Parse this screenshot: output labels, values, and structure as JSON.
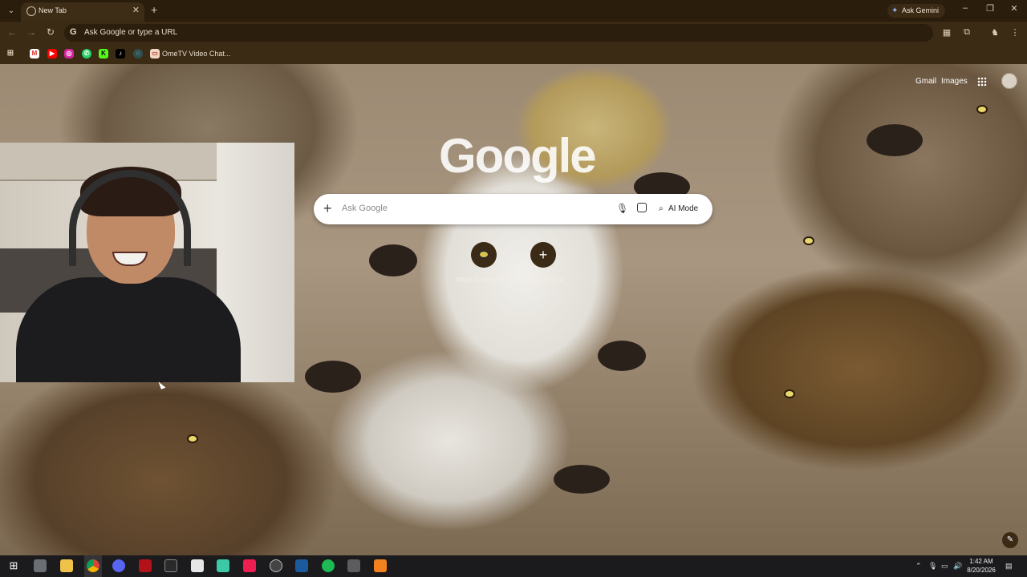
{
  "browser": {
    "tab": {
      "title": "New Tab"
    },
    "ask_gemini_label": "Ask Gemini",
    "omnibox_placeholder": "Ask Google or type a URL",
    "bookmark_label": "OmeTV Video Chat..."
  },
  "ntp": {
    "gmail_label": "Gmail",
    "images_label": "Images",
    "logo_text": "Google",
    "search_placeholder": "Ask Google",
    "ai_mode_label": "AI Mode",
    "shortcuts": [
      {
        "label": "https://www.me..."
      },
      {
        "label": "Add shortcut"
      }
    ]
  },
  "taskbar": {
    "time": "1:42 AM",
    "date": "8/20/2026"
  },
  "colors": {
    "browser_frame": "#2b1d0c",
    "toolbar": "#3b2a14",
    "taskbar": "#1b1b1d"
  }
}
